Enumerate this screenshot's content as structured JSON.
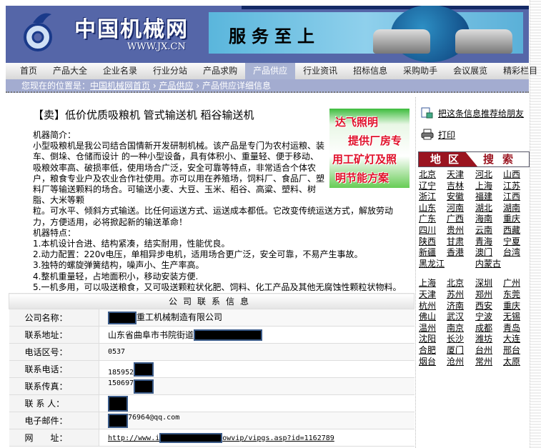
{
  "header": {
    "logo_text": "中国机械网",
    "logo_url": "WWW.JX.CN",
    "banner_slogan": "服务至上"
  },
  "nav": [
    "首页",
    "产品大全",
    "企业名录",
    "行业分站",
    "产品求购",
    "产品供应",
    "行业资讯",
    "招标信息",
    "采购助手",
    "会议展览",
    "精彩栏目"
  ],
  "breadcrumb": {
    "prefix": "您现在的位置是：",
    "home": "中国机械网首页",
    "sep": "›",
    "section": "产品供应",
    "current": "产品供应详细信息"
  },
  "product": {
    "title": "【卖】低价优质吸粮机 管式输送机 稻谷输送机",
    "intro_label": "机器简介：",
    "intro": "小型吸粮机是我公司结合国情新开发研制机械。该产品是专门为农村运粮、装车、倒垛、仓储而设计 的一种小型设备，具有体积小、重量轻、便于移动、吸粮效率高、破损率低，使用场合广泛，安全可靠等特点，非常适合个体农户，粮食专业户及农业合作社使用。亦可以用在养殖场，饲料厂、食品厂、塑料厂等输送颗料的场合。可输送小麦、大豆、玉米、稻谷、高粱、塑料、树脂、大米等颗",
    "intro_tail": "粒。可水平、倾斜方式输送。比任何运送方式、运送成本都低。它改变传统运送方式，解放劳动力，方便适用，必将掀起新的输送革命！",
    "features_label": "机器特点：",
    "features": [
      "1.本机设计合进、结构紧凑，结实耐用，性能优良。",
      "2.动力配置：220v电压，单相异步电机，适用场合更广泛，安全可靠，不易产生事故。",
      "3.独特的螺旋弹簧结构，噪声小、生产率高。",
      "4.整机重量轻，占地面积小，移动安装方便.",
      "5.一机多用，可以吸送粮食，又可吸送颗粒状化肥、饲料、化工产品及其他无腐蚀性颗粒状物料。"
    ]
  },
  "ad": {
    "lines": [
      "达飞照明",
      "提供厂房专",
      "用工矿灯及照",
      "明节能方案"
    ]
  },
  "contact": {
    "header": "公司联系信息",
    "rows": [
      {
        "label": "公司名称：",
        "value": "重工机械制造有限公司"
      },
      {
        "label": "联系地址：",
        "value": "山东省曲阜市书院街道"
      },
      {
        "label": "电话区号：",
        "value": "0537"
      },
      {
        "label": "联系电话：",
        "value": "185952"
      },
      {
        "label": "联系传真：",
        "value": "150697"
      },
      {
        "label": "联 系 人：",
        "value": ""
      },
      {
        "label": "电子邮件：",
        "value": "76964@qq.com"
      },
      {
        "label": "网　　址：",
        "value": "http://www.i",
        "value2": "owvip/vipgs.asp?id=1162789"
      }
    ]
  },
  "sidebar": {
    "recommend": "把这条信息推荐给朋友",
    "print": "打印",
    "region_a": "地区",
    "region_b": "搜索",
    "provinces": [
      "北京",
      "天津",
      "河北",
      "山西",
      "辽宁",
      "吉林",
      "上海",
      "江苏",
      "浙江",
      "安徽",
      "福建",
      "江西",
      "山东",
      "河南",
      "湖北",
      "湖南",
      "广东",
      "广西",
      "海南",
      "重庆",
      "四川",
      "贵州",
      "云南",
      "西藏",
      "陕西",
      "甘肃",
      "青海",
      "宁夏",
      "新疆",
      "香港",
      "澳门",
      "台湾",
      "黑龙江",
      "内蒙古"
    ],
    "cities": [
      "上海",
      "北京",
      "深圳",
      "广州",
      "天津",
      "苏州",
      "郑州",
      "东莞",
      "杭州",
      "济南",
      "西安",
      "重庆",
      "佛山",
      "武汉",
      "宁波",
      "无锡",
      "温州",
      "南京",
      "成都",
      "青岛",
      "沈阳",
      "长沙",
      "潍坊",
      "大连",
      "合肥",
      "厦门",
      "台州",
      "邢台",
      "烟台",
      "沧州",
      "常州",
      "太原"
    ]
  }
}
